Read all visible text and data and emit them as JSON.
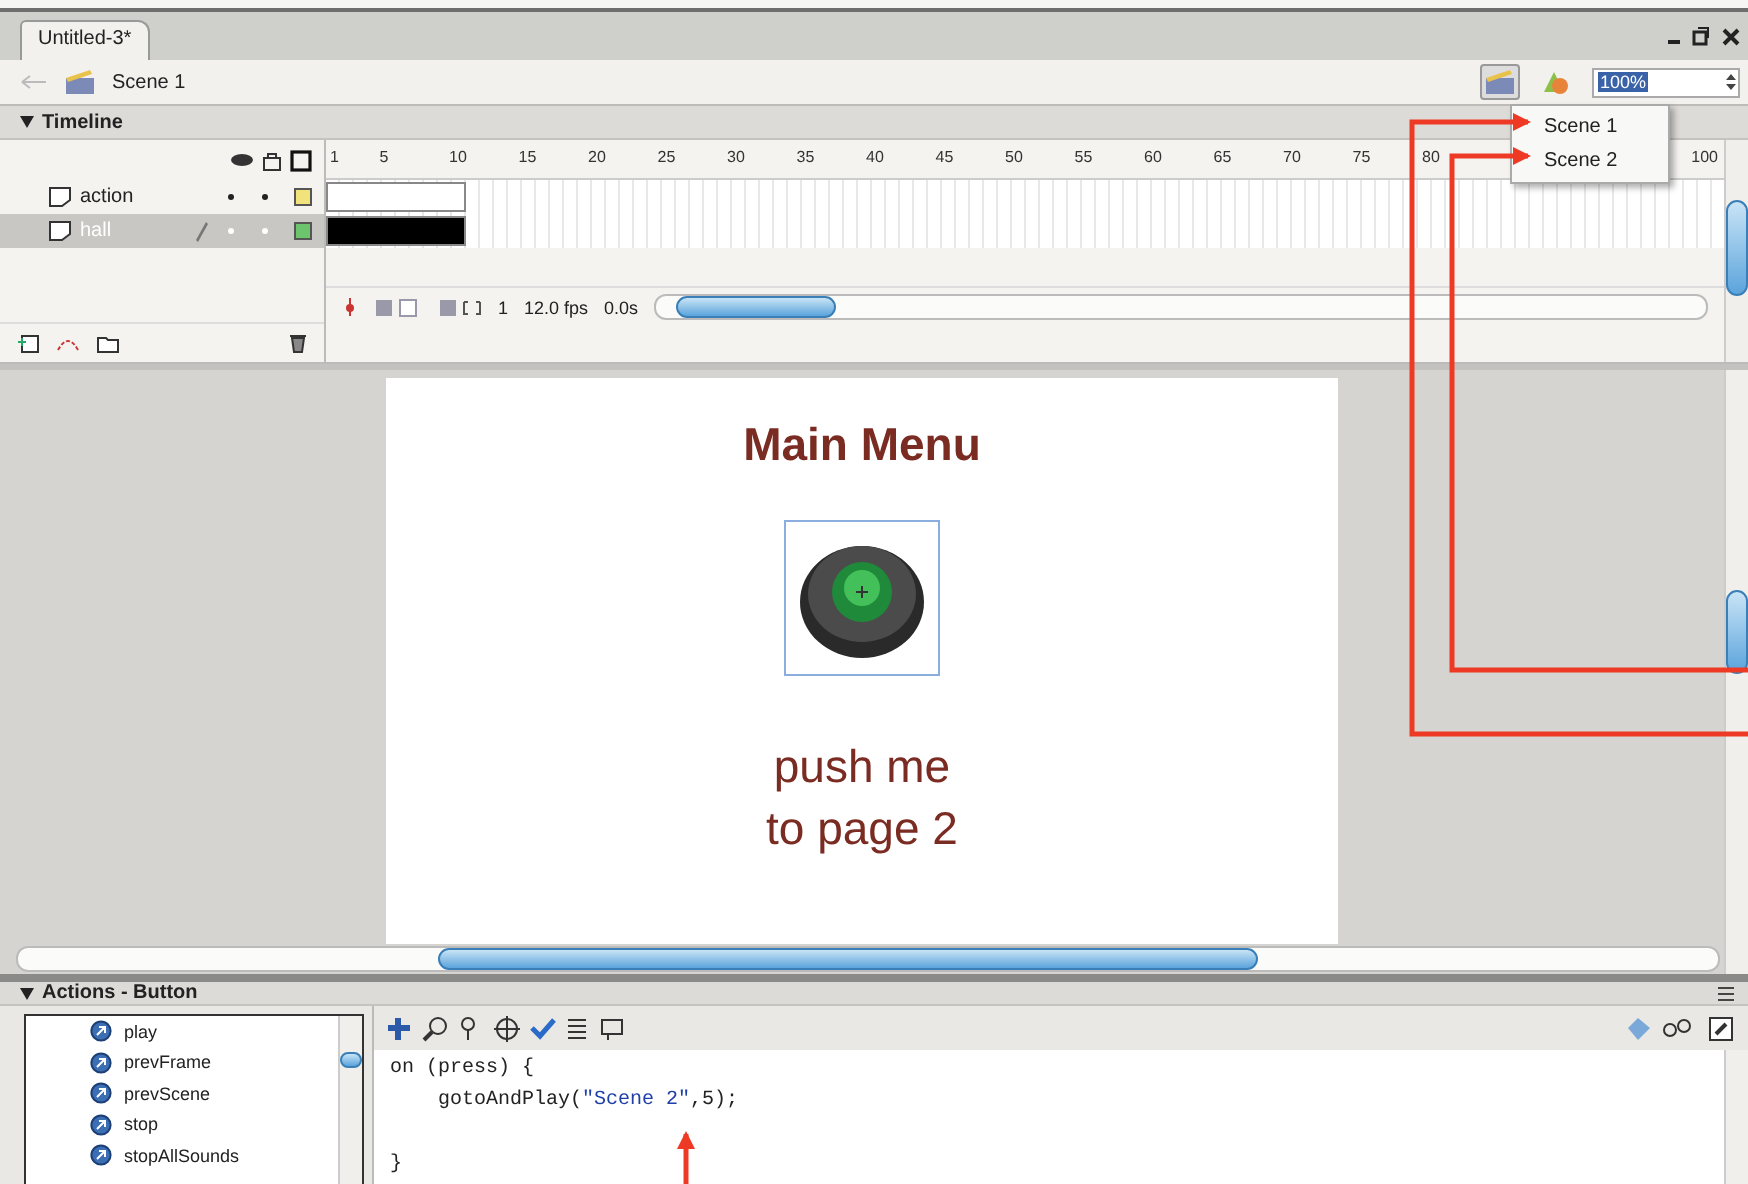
{
  "document_tab": {
    "label": "Untitled-3*",
    "selected": true
  },
  "breadcrumb": {
    "scene": "Scene 1"
  },
  "zoom": {
    "value": "100%"
  },
  "scene_menu": {
    "items": [
      {
        "label": "Scene 1"
      },
      {
        "label": "Scene 2"
      }
    ]
  },
  "timeline": {
    "title": "Timeline",
    "frame_numbers": [
      "1",
      "5",
      "10",
      "15",
      "20",
      "25",
      "30",
      "35",
      "40",
      "45",
      "50",
      "55",
      "60",
      "65",
      "70",
      "75",
      "80",
      "100"
    ],
    "layers": [
      {
        "name": "action",
        "selected": false,
        "color": "#f2e27c"
      },
      {
        "name": "hall",
        "selected": true,
        "color": "#6cc46c"
      }
    ],
    "current_frame": "1",
    "frame_rate": "12.0 fps",
    "elapsed": "0.0s"
  },
  "stage": {
    "title": "Main Menu",
    "caption_lines": [
      "push me",
      "to page 2"
    ]
  },
  "actions": {
    "title": "Actions - Button",
    "items": [
      {
        "label": "play"
      },
      {
        "label": "prevFrame"
      },
      {
        "label": "prevScene"
      },
      {
        "label": "stop"
      },
      {
        "label": "stopAllSounds"
      }
    ],
    "code": [
      {
        "gap_before": false,
        "segments": [
          {
            "kind": "plain",
            "text": "on (press) {"
          }
        ]
      },
      {
        "gap_before": false,
        "segments": [
          {
            "kind": "plain",
            "text": "    gotoAndPlay("
          },
          {
            "kind": "string",
            "text": "\"Scene 2\""
          },
          {
            "kind": "plain",
            "text": ",5);"
          }
        ]
      },
      {
        "gap_before": true,
        "segments": [
          {
            "kind": "plain",
            "text": "}"
          }
        ]
      }
    ]
  }
}
